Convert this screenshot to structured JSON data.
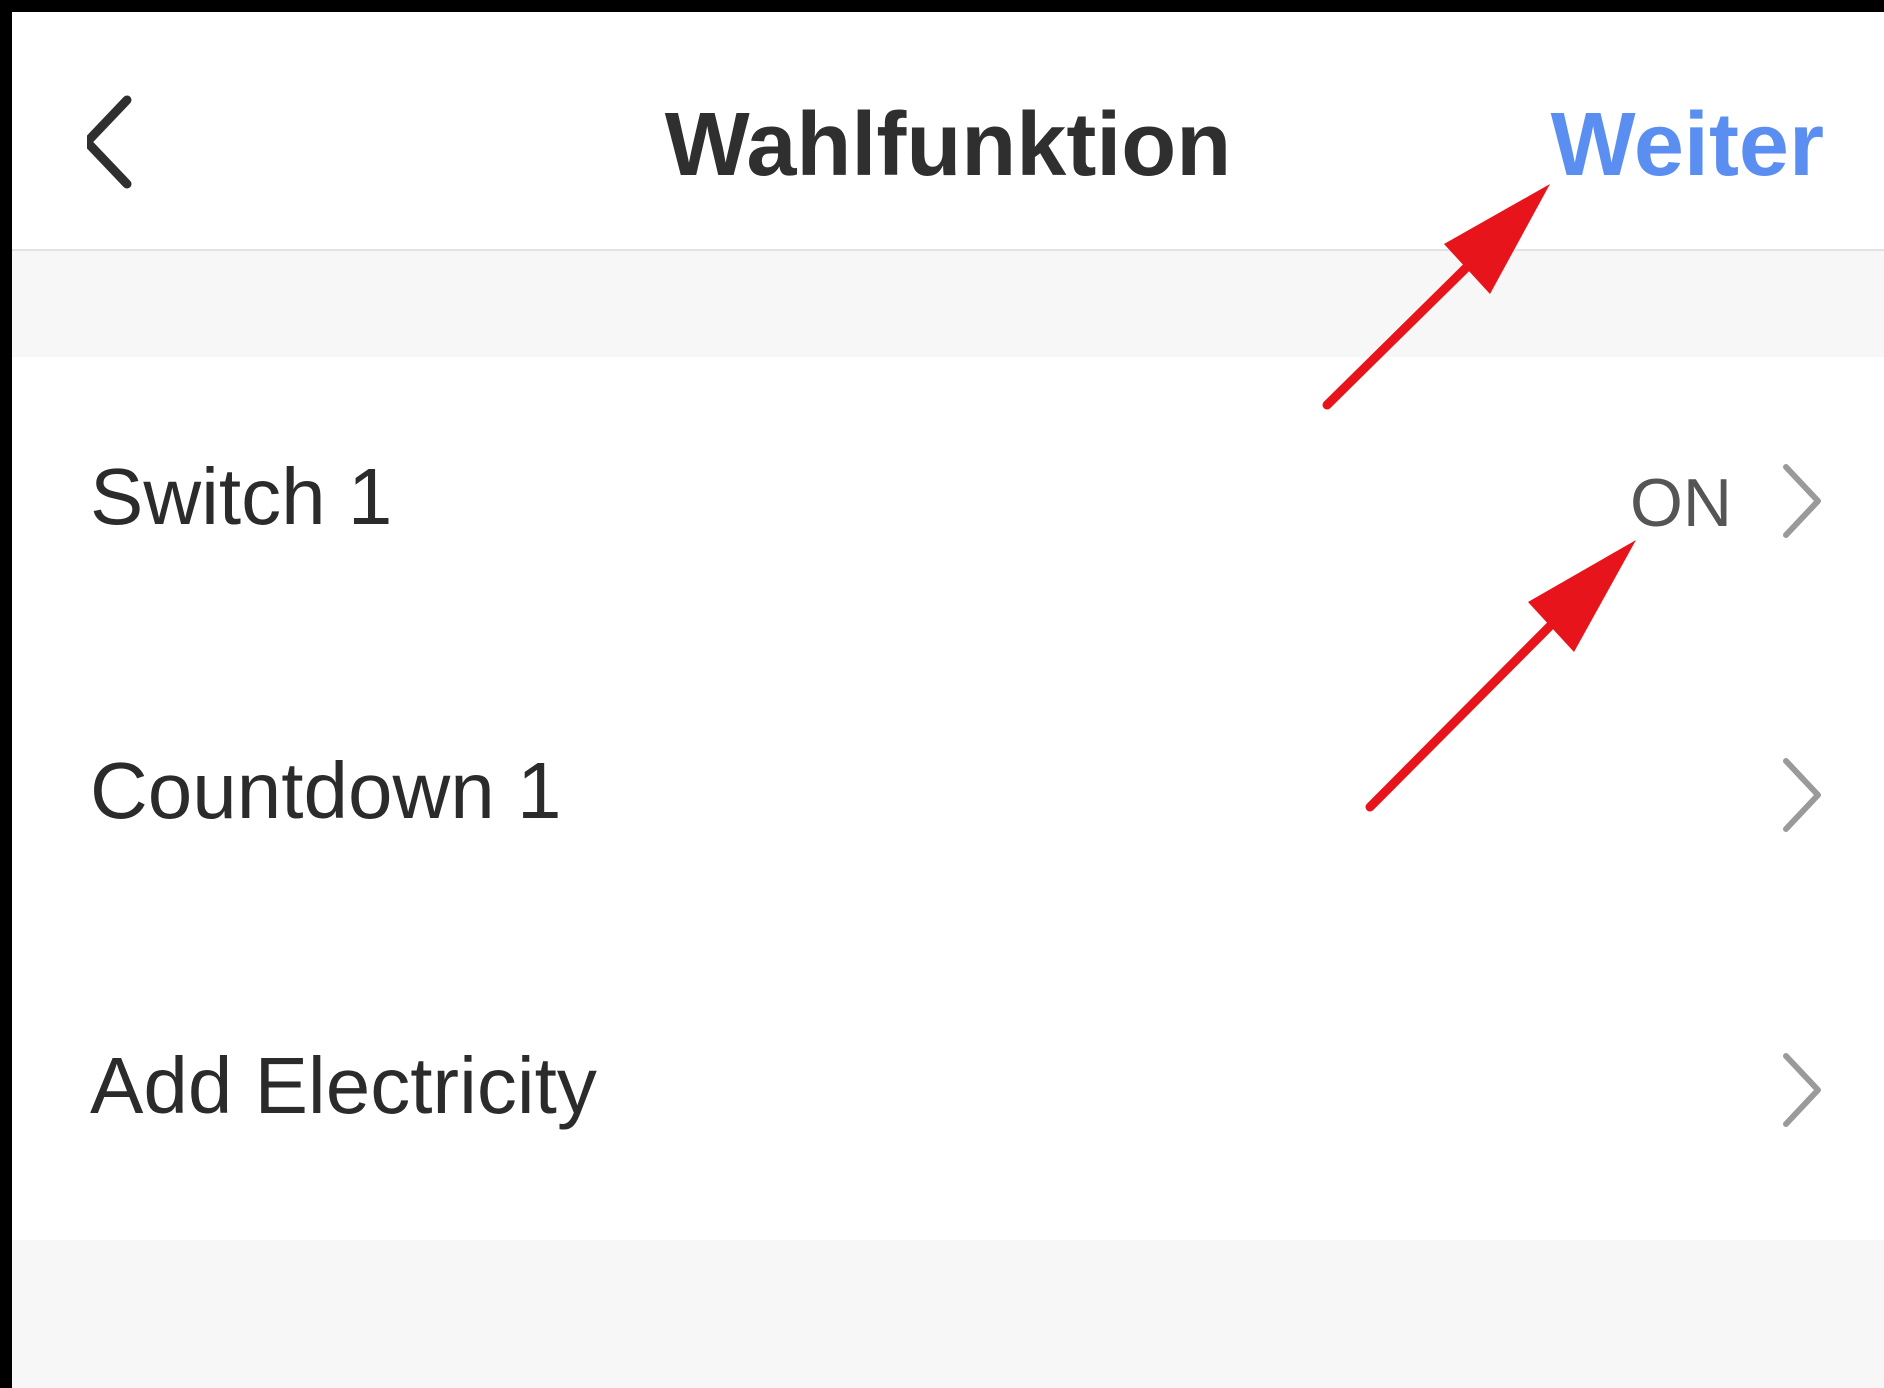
{
  "header": {
    "back_icon": "chevron-left-icon",
    "title": "Wahlfunktion",
    "next_label": "Weiter",
    "next_color": "#5a8ef0"
  },
  "rows": [
    {
      "label": "Switch 1",
      "value": "ON",
      "icon": "chevron-right-icon"
    },
    {
      "label": "Countdown 1",
      "value": "",
      "icon": "chevron-right-icon"
    },
    {
      "label": "Add Electricity",
      "value": "",
      "icon": "chevron-right-icon"
    }
  ],
  "annotations": {
    "arrow_color": "#e8141b",
    "arrow_icon": "red-arrow-icon"
  }
}
